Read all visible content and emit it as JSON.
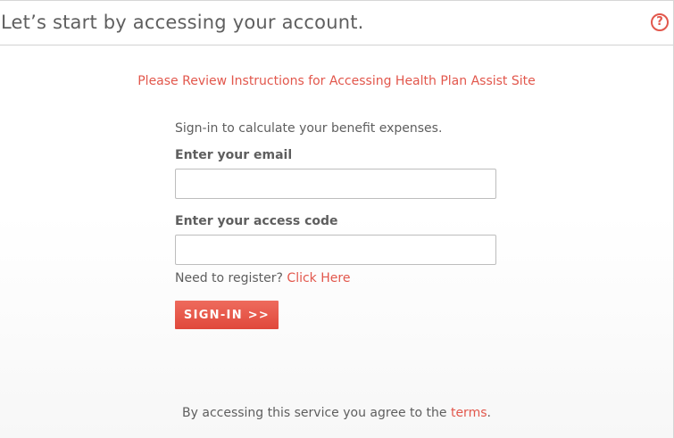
{
  "header": {
    "title": "Let’s start by accessing your account.",
    "help_icon": "question-circle-icon",
    "help_glyph": "?"
  },
  "instructions_link": "Please Review Instructions for Accessing Health Plan Assist Site",
  "form": {
    "subtitle": "Sign-in to calculate your benefit expenses.",
    "email_label": "Enter your email",
    "email_value": "",
    "access_code_label": "Enter your access code",
    "access_code_value": "",
    "register_prompt": "Need to register?",
    "register_link": "Click Here",
    "signin_label": "SIGN-IN >>"
  },
  "footer": {
    "terms_prefix": "By accessing this service you agree to the",
    "terms_link": "terms",
    "terms_suffix": "."
  },
  "colors": {
    "accent": "#e2574c",
    "text": "#5e5e5e",
    "border": "#bdbdbd"
  }
}
